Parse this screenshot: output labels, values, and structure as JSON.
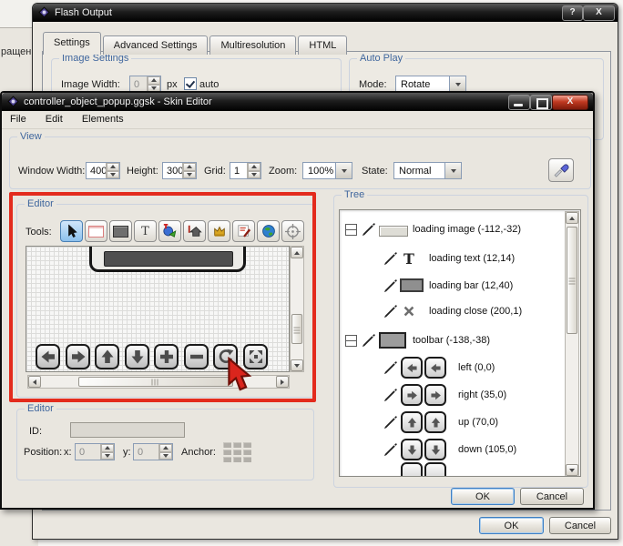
{
  "background": {
    "partial_text": "ращени"
  },
  "flash_output": {
    "title": "Flash Output",
    "help_button": "?",
    "close_button": "X",
    "tabs": [
      {
        "label": "Settings",
        "active": true
      },
      {
        "label": "Advanced Settings",
        "active": false
      },
      {
        "label": "Multiresolution",
        "active": false
      },
      {
        "label": "HTML",
        "active": false
      }
    ],
    "image_settings": {
      "legend": "Image Settings",
      "image_width_label": "Image Width:",
      "image_width_value": "0",
      "px_label": "px",
      "auto_label": "auto",
      "auto_checked": true
    },
    "auto_play": {
      "legend": "Auto Play",
      "mode_label": "Mode:",
      "mode_value": "Rotate"
    },
    "ok_label": "OK",
    "cancel_label": "Cancel"
  },
  "skin_editor": {
    "title": "controller_object_popup.ggsk - Skin Editor",
    "close_button": "X",
    "menu": {
      "file": "File",
      "edit": "Edit",
      "elements": "Elements"
    },
    "view": {
      "legend": "View",
      "window_width_label": "Window Width:",
      "window_width_value": "400",
      "height_label": "Height:",
      "height_value": "300",
      "grid_label": "Grid:",
      "grid_value": "1",
      "zoom_label": "Zoom:",
      "zoom_value": "100%",
      "state_label": "State:",
      "state_value": "Normal"
    },
    "editor": {
      "legend": "Editor",
      "tools_label": "Tools:",
      "tools": [
        "select",
        "rectangle",
        "bar",
        "text",
        "image",
        "button",
        "ornament",
        "note",
        "world",
        "target"
      ]
    },
    "tree": {
      "legend": "Tree",
      "items": [
        {
          "label": "loading image (-112,-32)"
        },
        {
          "label": "loading text (12,14)"
        },
        {
          "label": "loading bar (12,40)"
        },
        {
          "label": "loading close (200,1)"
        },
        {
          "label": "toolbar (-138,-38)"
        },
        {
          "label": "left (0,0)"
        },
        {
          "label": "right (35,0)"
        },
        {
          "label": "up (70,0)"
        },
        {
          "label": "down (105,0)"
        }
      ]
    },
    "properties": {
      "legend": "Editor",
      "id_label": "ID:",
      "id_value": "",
      "position_label": "Position:",
      "x_label": "x:",
      "x_value": "0",
      "y_label": "y:",
      "y_value": "0",
      "anchor_label": "Anchor:"
    },
    "ok_label": "OK",
    "cancel_label": "Cancel"
  },
  "icons": {
    "text_glyph": "T"
  },
  "colors": {
    "accent_blue": "#40679e",
    "annotation_red": "#e32b1d",
    "titlebar_dark": "#1d1d1d",
    "close_red": "#c03a22",
    "selected_tool_blue": "#8cc0ec"
  }
}
